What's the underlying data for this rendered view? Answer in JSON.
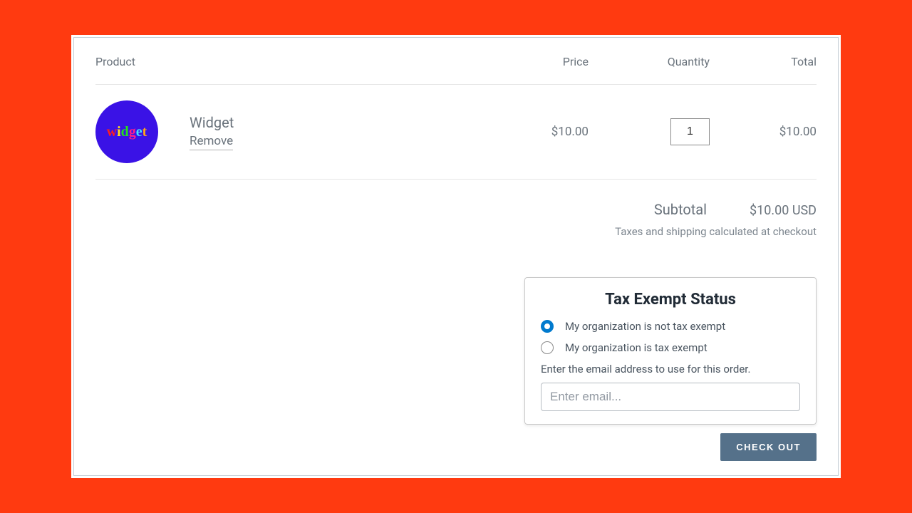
{
  "columns": {
    "product": "Product",
    "price": "Price",
    "quantity": "Quantity",
    "total": "Total"
  },
  "item": {
    "name": "Widget",
    "remove_label": "Remove",
    "price": "$10.00",
    "quantity": "1",
    "line_total": "$10.00",
    "thumb_text": "widget"
  },
  "summary": {
    "subtotal_label": "Subtotal",
    "subtotal_value": "$10.00 USD",
    "tax_note": "Taxes and shipping calculated at checkout"
  },
  "exempt": {
    "title": "Tax Exempt Status",
    "not_exempt_label": "My organization is not tax exempt",
    "exempt_label": "My organization is tax exempt",
    "selected": "not_exempt",
    "email_prompt": "Enter the email address to use for this order.",
    "email_placeholder": "Enter email...",
    "email_value": ""
  },
  "checkout_label": "Check Out"
}
